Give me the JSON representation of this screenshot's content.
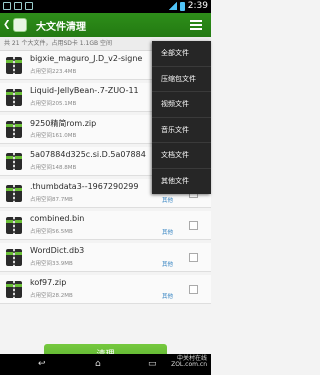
{
  "status_bar": {
    "time": "2:39"
  },
  "header": {
    "back_icon": "back-arrow-icon",
    "title": "大文件清理"
  },
  "summary": "共 21 个大文件，占用SD卡 1.1GB 空间",
  "files": [
    {
      "name": "bigxie_maguro_J.D_v2-signe",
      "size": "占用空间223.4MB",
      "tag": ""
    },
    {
      "name": "Liquid-JellyBean-.7-ZUO-11",
      "size": "占用空间205.1MB",
      "tag": ""
    },
    {
      "name": "9250精简rom.zip",
      "size": "占用空间161.0MB",
      "tag": ""
    },
    {
      "name": "5a07884d325c.si.D.5a07884",
      "size": "占用空间148.8MB",
      "tag": ""
    },
    {
      "name": ".thumbdata3--1967290299",
      "size": "占用空间87.7MB",
      "tag": "其他"
    },
    {
      "name": "combined.bin",
      "size": "占用空间56.5MB",
      "tag": "其他"
    },
    {
      "name": "WordDict.db3",
      "size": "占用空间33.9MB",
      "tag": "其他"
    },
    {
      "name": "kof97.zip",
      "size": "占用空间28.2MB",
      "tag": "其他"
    }
  ],
  "dropdown": [
    "全部文件",
    "压缩包文件",
    "视频文件",
    "音乐文件",
    "文档文件",
    "其他文件"
  ],
  "actions": {
    "clean": "清理"
  },
  "watermark": "中关村在线\nZOL.com.cn"
}
